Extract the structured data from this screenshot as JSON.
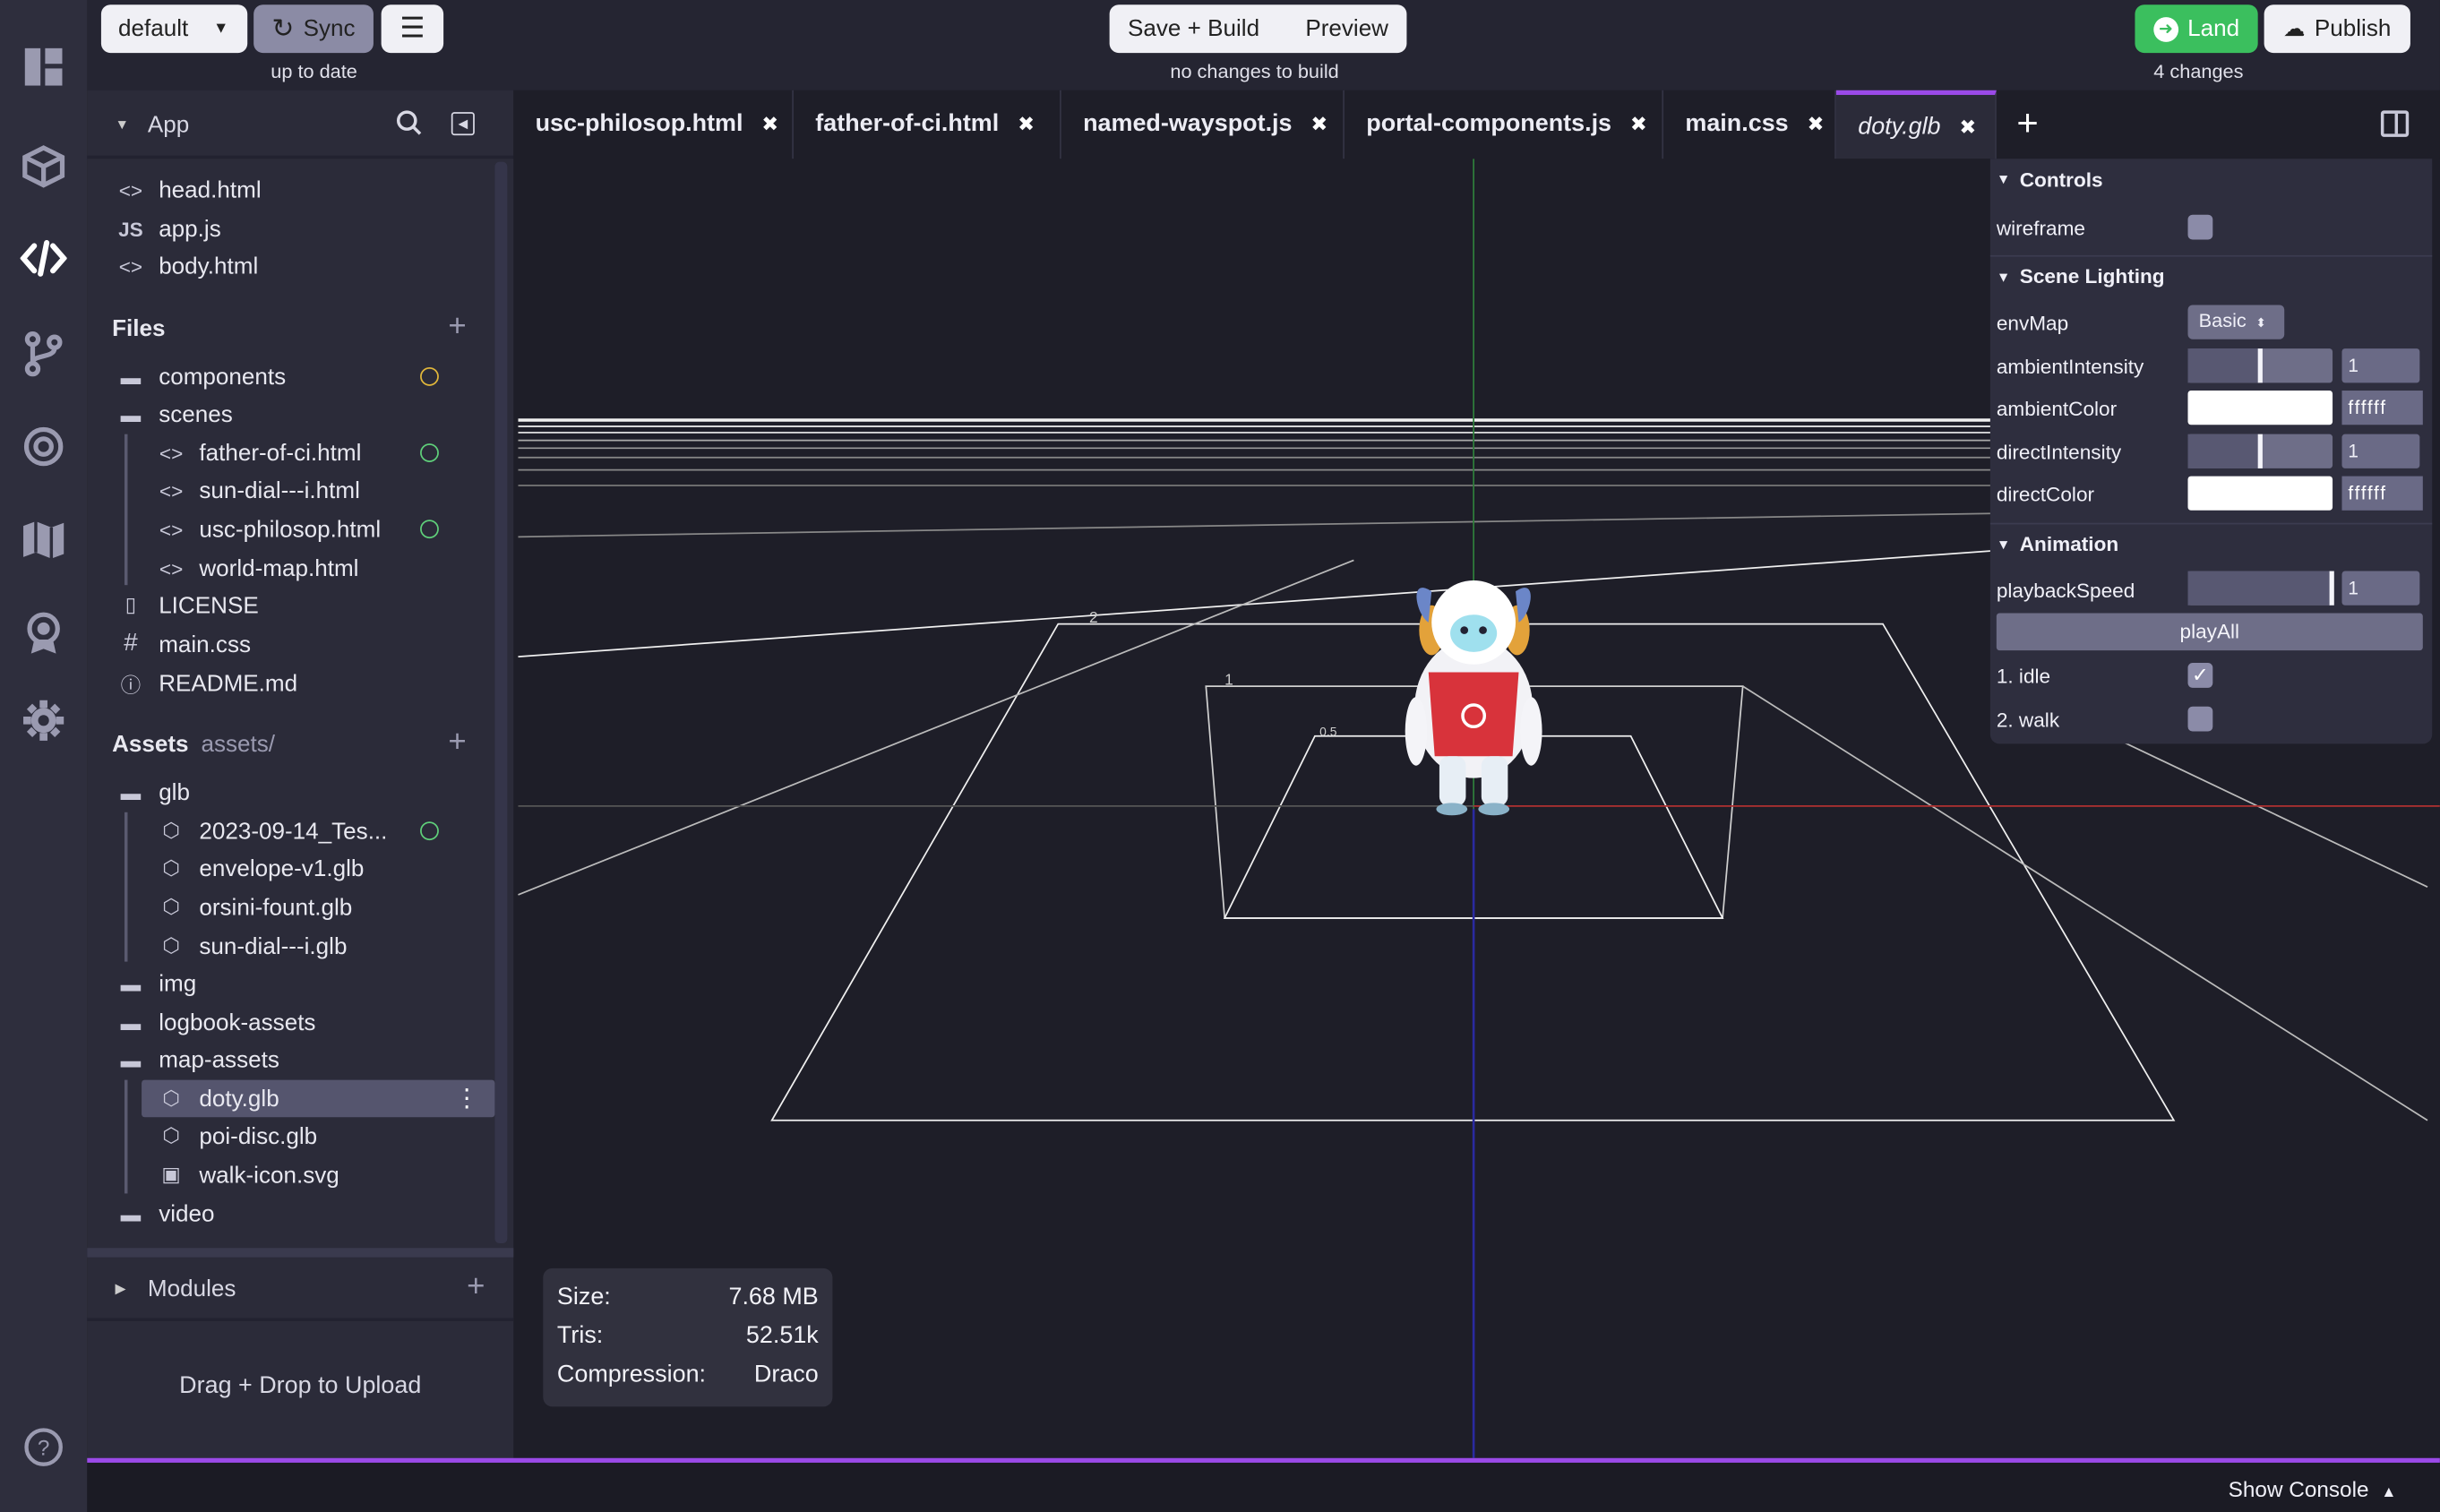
{
  "topbar": {
    "branch": "default",
    "sync_label": "Sync",
    "sync_status": "up to date",
    "menu_icon": "hamburger-icon",
    "save_build_label": "Save + Build",
    "preview_label": "Preview",
    "build_status": "no changes to build",
    "land_label": "Land",
    "publish_label": "Publish",
    "changes_status": "4 changes"
  },
  "rail": {
    "icons": [
      "dashboard-icon",
      "cube-icon",
      "code-icon",
      "branch-icon",
      "target-icon",
      "map-icon",
      "badge-icon",
      "gear-icon",
      "help-icon"
    ]
  },
  "sidebar": {
    "app_label": "App",
    "app_files": [
      {
        "icon": "<>",
        "name": "head.html"
      },
      {
        "icon": "JS",
        "name": "app.js"
      },
      {
        "icon": "<>",
        "name": "body.html"
      }
    ],
    "files_label": "Files",
    "files": {
      "components": "components",
      "scenes": "scenes",
      "scene_items": [
        "father-of-ci.html",
        "sun-dial---i.html",
        "usc-philosop.html",
        "world-map.html"
      ],
      "license": "LICENSE",
      "main_css": "main.css",
      "readme": "README.md"
    },
    "assets_label": "Assets",
    "assets_path": "assets/",
    "assets": {
      "glb": "glb",
      "glb_items": [
        "2023-09-14_Tes...",
        "envelope-v1.glb",
        "orsini-fount.glb",
        "sun-dial---i.glb"
      ],
      "img": "img",
      "logbook": "logbook-assets",
      "map_assets": "map-assets",
      "map_items": [
        "doty.glb",
        "poi-disc.glb",
        "walk-icon.svg"
      ],
      "video": "video"
    },
    "modules_label": "Modules",
    "upload_label": "Drag + Drop to Upload"
  },
  "tabs": [
    {
      "label": "usc-philosop.html"
    },
    {
      "label": "father-of-ci.html"
    },
    {
      "label": "named-wayspot.js"
    },
    {
      "label": "portal-components.js"
    },
    {
      "label": "main.css"
    },
    {
      "label": "doty.glb"
    }
  ],
  "controls": {
    "controls_title": "Controls",
    "wireframe": "wireframe",
    "lighting_title": "Scene Lighting",
    "envmap_label": "envMap",
    "envmap_value": "Basic",
    "ambient_intensity_label": "ambientIntensity",
    "ambient_intensity_value": "1",
    "ambient_color_label": "ambientColor",
    "ambient_color_value": "ffffff",
    "direct_intensity_label": "directIntensity",
    "direct_intensity_value": "1",
    "direct_color_label": "directColor",
    "direct_color_value": "ffffff",
    "animation_title": "Animation",
    "playback_label": "playbackSpeed",
    "playback_value": "1",
    "playall_label": "playAll",
    "anim1": "1. idle",
    "anim2": "2. walk",
    "anim1_checked": true,
    "anim2_checked": false
  },
  "info": {
    "size_label": "Size:",
    "size_value": "7.68 MB",
    "tris_label": "Tris:",
    "tris_value": "52.51k",
    "compression_label": "Compression:",
    "compression_value": "Draco"
  },
  "viewport": {
    "grid_labels": [
      "1",
      "2",
      "0.5"
    ]
  },
  "bottom": {
    "console_label": "Show Console"
  },
  "colors": {
    "accent": "#9b4ae8",
    "land": "#3bbf5e",
    "folder_ring": "#e0b63a",
    "file_ring": "#5fcf7a"
  }
}
